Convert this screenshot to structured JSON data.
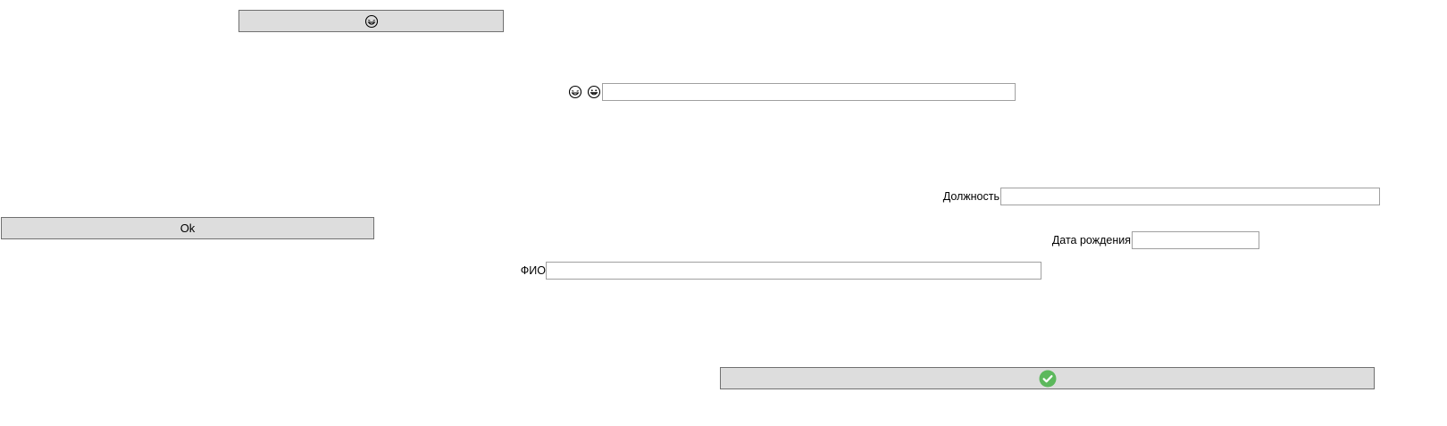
{
  "buttons": {
    "top_icon": "laughing-face-icon",
    "ok_label": "Ok",
    "confirm_icon": "check-circle-icon"
  },
  "emoji_row": {
    "icons": [
      "laughing-face-icon",
      "grinning-face-icon"
    ],
    "value": ""
  },
  "form": {
    "position_label": "Должность",
    "position_value": "",
    "birthdate_label": "Дата рождения",
    "birthdate_value": "",
    "fullname_label": "ФИО",
    "fullname_value": ""
  },
  "colors": {
    "button_bg": "#dddddd",
    "button_border": "#707070",
    "field_border": "#a0a0a0",
    "check_green": "#5cb85c"
  }
}
